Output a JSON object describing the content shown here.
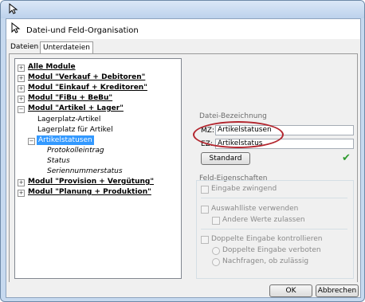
{
  "window": {
    "title": "Datei-und Feld-Organisation"
  },
  "tabs": [
    {
      "label": "Dateien"
    },
    {
      "label": "Unterdateien"
    }
  ],
  "tree": {
    "items": [
      {
        "label": "Alle Module"
      },
      {
        "label": "Modul \"Verkauf + Debitoren\""
      },
      {
        "label": "Modul \"Einkauf + Kreditoren\""
      },
      {
        "label": "Modul \"FiBu + BeBu\""
      },
      {
        "label": "Modul \"Artikel + Lager\""
      },
      {
        "label": "Lagerplatz-Artikel"
      },
      {
        "label": "Lagerplatz für Artikel"
      },
      {
        "label": "Artikelstatusen"
      },
      {
        "label": "Protokolleintrag"
      },
      {
        "label": "Status"
      },
      {
        "label": "Seriennummerstatus"
      },
      {
        "label": "Modul \"Provision + Vergütung\""
      },
      {
        "label": "Modul \"Planung + Produktion\""
      }
    ],
    "expander_collapsed": "+",
    "expander_expanded": "−"
  },
  "datei": {
    "section_label": "Datei-Bezeichnung",
    "mz_label": "MZ:",
    "mz_value": "Artikelstatusen",
    "ez_label": "EZ:",
    "ez_value": "Artikelstatus",
    "standard_button": "Standard",
    "check_icon": "✔"
  },
  "feld": {
    "section_label": "Feld-Eigenschaften",
    "eingabe_zwingend": "Eingabe zwingend",
    "auswahlliste": "Auswahlliste verwenden",
    "andere_werte": "Andere Werte zulassen",
    "doppelte_kontrollieren": "Doppelte Eingabe kontrollieren",
    "doppelte_verboten": "Doppelte Eingabe verboten",
    "nachfragen": "Nachfragen, ob zulässig"
  },
  "buttons": {
    "ok": "OK",
    "cancel": "Abbrechen"
  },
  "colors": {
    "accent": "#3399ff",
    "highlight_oval": "#b3262f",
    "check_green": "#2e9a2e"
  }
}
